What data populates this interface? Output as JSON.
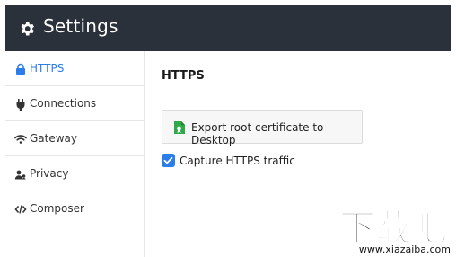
{
  "app": {
    "title": "Settings",
    "icon": "gear-icon"
  },
  "sidebar": {
    "items": [
      {
        "label": "HTTPS",
        "icon": "lock-icon",
        "active": true
      },
      {
        "label": "Connections",
        "icon": "plug-icon",
        "active": false
      },
      {
        "label": "Gateway",
        "icon": "wifi-icon",
        "active": false
      },
      {
        "label": "Privacy",
        "icon": "users-icon",
        "active": false
      },
      {
        "label": "Composer",
        "icon": "code-icon",
        "active": false
      }
    ]
  },
  "main": {
    "section_title": "HTTPS",
    "export_button": {
      "label": "Export root certificate to Desktop",
      "icon": "certificate-icon"
    },
    "capture_checkbox": {
      "label": "Capture HTTPS traffic",
      "checked": true
    }
  },
  "watermark": {
    "logo_text": "下载吧",
    "url": "www.xiazaiba.com"
  },
  "colors": {
    "titlebar": "#2b313b",
    "accent": "#2b7de9",
    "cert_green": "#2eaa4a"
  }
}
